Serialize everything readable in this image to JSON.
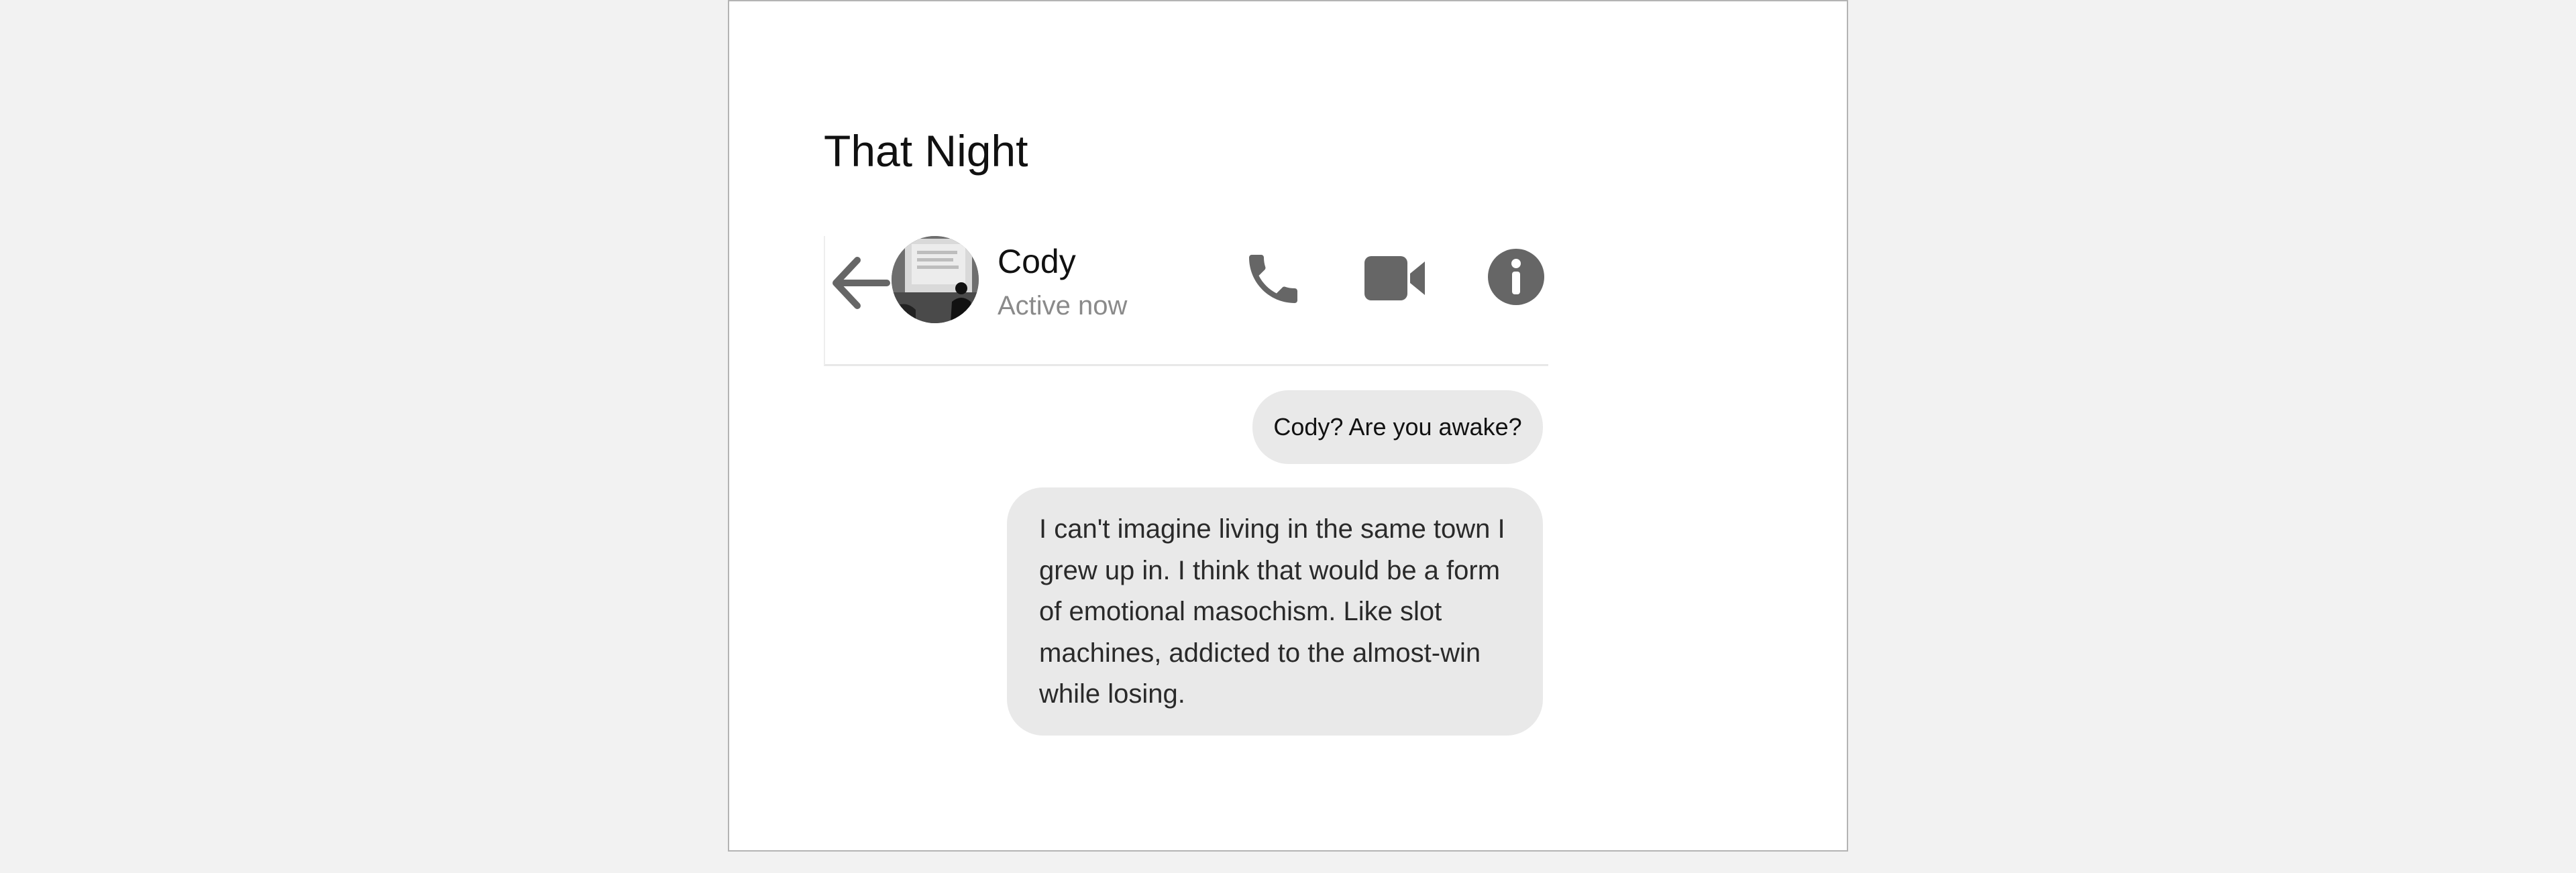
{
  "page": {
    "title": "That Night"
  },
  "chat": {
    "contact_name": "Cody",
    "contact_status": "Active now",
    "icons": {
      "back": "arrow-left-icon",
      "call": "phone-icon",
      "video": "video-camera-icon",
      "info": "info-icon"
    },
    "icon_color": "#666666"
  },
  "messages": [
    {
      "text": "Cody? Are you awake?"
    },
    {
      "text": "I can't imagine living in the same town I grew up in. I think that would be a form of emotional masochism. Like slot machines, addicted to the almost-win while losing."
    }
  ],
  "colors": {
    "bubble_background": "#e9e9e9",
    "status_text": "#8a8a8a"
  }
}
